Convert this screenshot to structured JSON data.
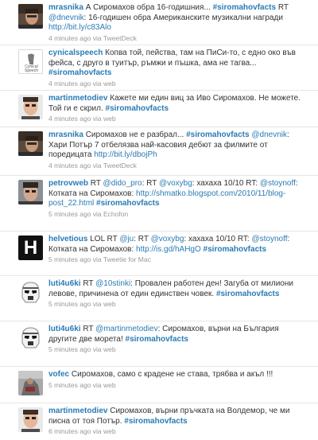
{
  "timeline": {
    "tweets": [
      {
        "avatar_icon": "user-photo-icon",
        "user": "mrasnika",
        "parts": [
          {
            "kind": "text",
            "value": " А Сиромахов обра 16-годишния... "
          },
          {
            "kind": "hashtag",
            "value": "#siromahovfacts"
          },
          {
            "kind": "text",
            "value": " RT "
          },
          {
            "kind": "link",
            "value": "@dnevnik"
          },
          {
            "kind": "text",
            "value": ": 16-годишен обра Американските музикални награди "
          },
          {
            "kind": "link",
            "value": "http://bit.ly/c83Alo"
          }
        ],
        "time": "4 minutes ago",
        "via_prefix": " via ",
        "via": "TweetDeck"
      },
      {
        "avatar_icon": "cynical-speech-logo-icon",
        "avatar_text": "Cynical Speech",
        "user": "cynicalspeech",
        "parts": [
          {
            "kind": "text",
            "value": " Копва той, пейства, там на ПиСи-то, с едно око във фейса, с друго в туитър, ръмжи и пъшка, ама не тагва... "
          },
          {
            "kind": "hashtag",
            "value": "#siromahovfacts"
          }
        ],
        "time": "4 minutes ago",
        "via_prefix": " via ",
        "via": "web"
      },
      {
        "avatar_icon": "user-photo-icon",
        "user": "martinmetodiev",
        "parts": [
          {
            "kind": "text",
            "value": " Кажете ми един виц за Иво Сиромахов. Не можете. Той ги е скрил. "
          },
          {
            "kind": "hashtag",
            "value": "#siromahovfacts"
          }
        ],
        "time": "4 minutes ago",
        "via_prefix": " via ",
        "via": "web"
      },
      {
        "avatar_icon": "user-photo-icon",
        "user": "mrasnika",
        "parts": [
          {
            "kind": "text",
            "value": " Сиромахов не е разбрал... "
          },
          {
            "kind": "hashtag",
            "value": "#siromahovfacts"
          },
          {
            "kind": "text",
            "value": " "
          },
          {
            "kind": "link",
            "value": "@dnevnik"
          },
          {
            "kind": "text",
            "value": ": Хари Потър 7 отбелязва най-касовия дебют за филмите от поредицата "
          },
          {
            "kind": "link",
            "value": "http://bit.ly/dbojPh"
          }
        ],
        "time": "4 minutes ago",
        "via_prefix": " via ",
        "via": "TweetDeck"
      },
      {
        "avatar_icon": "user-photo-icon",
        "user": "petrovweb",
        "parts": [
          {
            "kind": "text",
            "value": " RT "
          },
          {
            "kind": "link",
            "value": "@dido_pro"
          },
          {
            "kind": "text",
            "value": ": RT "
          },
          {
            "kind": "link",
            "value": "@voxybg"
          },
          {
            "kind": "text",
            "value": ": хахаха 10/10 RT: "
          },
          {
            "kind": "link",
            "value": "@stoynoff"
          },
          {
            "kind": "text",
            "value": ": Котката на Сиромахов: "
          },
          {
            "kind": "link",
            "value": "http://shmatko.blogspot.com/2010/11/blog-post_22.html"
          },
          {
            "kind": "text",
            "value": " "
          },
          {
            "kind": "hashtag",
            "value": "#siromahovfacts"
          }
        ],
        "time": "5 minutes ago",
        "via_prefix": " via ",
        "via": "Echofon"
      },
      {
        "avatar_icon": "h-letter-logo-icon",
        "avatar_text": "H",
        "user": "helvetious",
        "parts": [
          {
            "kind": "text",
            "value": " LOL RT "
          },
          {
            "kind": "link",
            "value": "@ju"
          },
          {
            "kind": "text",
            "value": ": RT "
          },
          {
            "kind": "link",
            "value": "@voxybg"
          },
          {
            "kind": "text",
            "value": ": хахаха 10/10 RT: "
          },
          {
            "kind": "link",
            "value": "@stoynoff"
          },
          {
            "kind": "text",
            "value": ": Котката на Сиромахов: "
          },
          {
            "kind": "link",
            "value": "http://is.gd/hAHgO"
          },
          {
            "kind": "text",
            "value": " "
          },
          {
            "kind": "hashtag",
            "value": "#siromahovfacts"
          }
        ],
        "time": "5 minutes ago",
        "via_prefix": " via ",
        "via": "Tweetie for Mac"
      },
      {
        "avatar_icon": "stormtrooper-icon",
        "user": "luti4u6ki",
        "parts": [
          {
            "kind": "text",
            "value": " RT "
          },
          {
            "kind": "link",
            "value": "@10stinki"
          },
          {
            "kind": "text",
            "value": ": Провален работен ден! Загуба от милиони левове, причинена от един единствен човек. "
          },
          {
            "kind": "hashtag",
            "value": "#siromahovfacts"
          }
        ],
        "time": "5 minutes ago",
        "via_prefix": " via ",
        "via": "web"
      },
      {
        "avatar_icon": "stormtrooper-icon",
        "user": "luti4u6ki",
        "parts": [
          {
            "kind": "text",
            "value": " RT "
          },
          {
            "kind": "link",
            "value": "@martinmetodiev"
          },
          {
            "kind": "text",
            "value": ": Сиромахов, върни на България другите две морета! "
          },
          {
            "kind": "hashtag",
            "value": "#siromahovfacts"
          }
        ],
        "time": "5 minutes ago",
        "via_prefix": " via ",
        "via": "web"
      },
      {
        "avatar_icon": "user-photo-icon",
        "user": "vofec",
        "parts": [
          {
            "kind": "text",
            "value": " Сиромахов, само с крадене не става, трябва и акъл !!!"
          }
        ],
        "time": "5 minutes ago",
        "via_prefix": " via ",
        "via": "web"
      },
      {
        "avatar_icon": "user-photo-icon",
        "user": "martinmetodiev",
        "parts": [
          {
            "kind": "text",
            "value": " Сиромахов, върни пръчката на Волдемор, че ми писна от тоя Потър. "
          },
          {
            "kind": "hashtag",
            "value": "#siromahovfacts"
          }
        ],
        "time": "6 minutes ago",
        "via_prefix": " via ",
        "via": "web"
      }
    ]
  }
}
